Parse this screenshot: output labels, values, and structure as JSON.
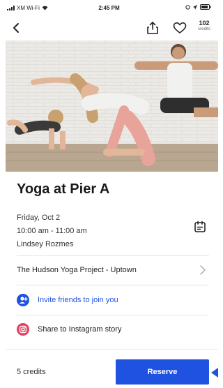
{
  "status_bar": {
    "carrier": "XM Wi-Fi",
    "time": "2:45 PM"
  },
  "nav": {
    "back_icon": "chevron-left-icon",
    "share_icon": "share-icon",
    "favorite_icon": "heart-icon",
    "credits_count": "102",
    "credits_label": "credits"
  },
  "class": {
    "title": "Yoga at Pier A",
    "date": "Friday, Oct 2",
    "time": "10:00 am - 11:00 am",
    "instructor": "Lindsey Rozmes"
  },
  "studio": {
    "name": "The Hudson Yoga Project - Uptown"
  },
  "actions": {
    "invite_label": "Invite friends to join you",
    "instagram_label": "Share to Instagram story"
  },
  "footer": {
    "credits_cost": "5 credits",
    "reserve_label": "Reserve"
  },
  "colors": {
    "accent": "#1f52e0",
    "instagram": "#e4405f"
  }
}
